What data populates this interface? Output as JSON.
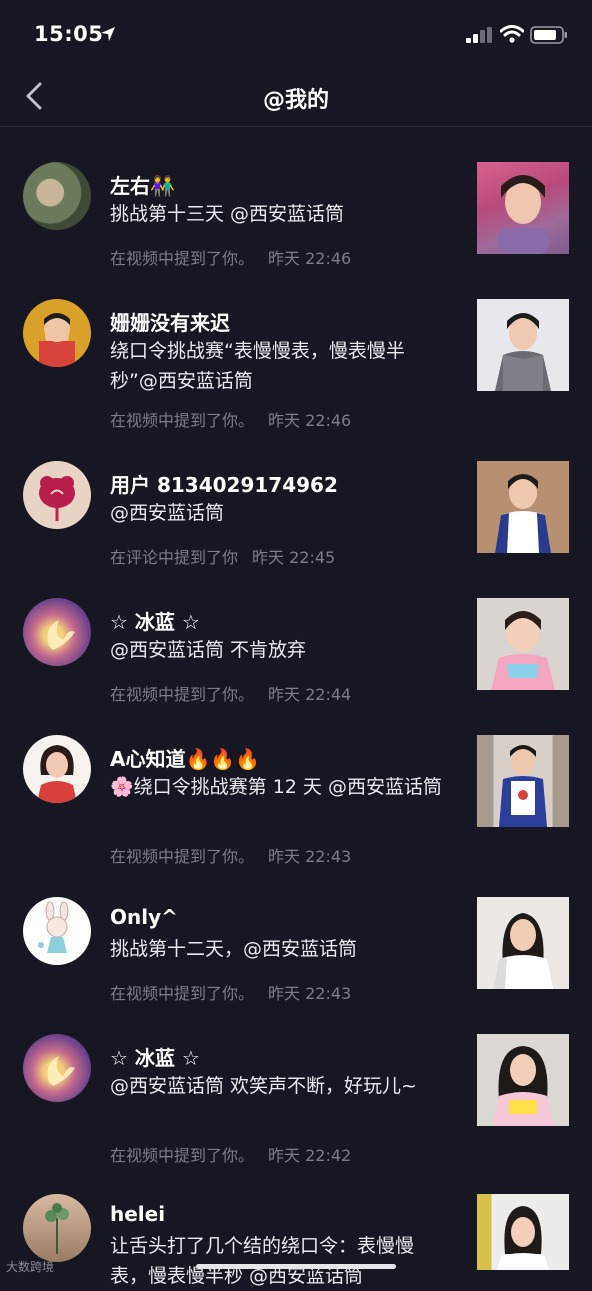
{
  "status_bar": {
    "time": "15:05"
  },
  "header": {
    "title": "@我的"
  },
  "mentions": [
    {
      "name": "左右👫",
      "message": "挑战第十三天 @西安蓝话筒",
      "source": "在视频中提到了你。",
      "time": "昨天 22:46"
    },
    {
      "name": "姗姗没有来迟",
      "message": "绕口令挑战赛“表慢慢表，慢表慢半秒”@西安蓝话筒",
      "source": "在视频中提到了你。",
      "time": "昨天 22:46"
    },
    {
      "name": "用户 8134029174962",
      "message": "@西安蓝话筒",
      "source": "在评论中提到了你",
      "time": "昨天 22:45"
    },
    {
      "name": "☆ 冰蓝 ☆",
      "message": "@西安蓝话筒 不肯放弃",
      "source": "在视频中提到了你。",
      "time": "昨天 22:44"
    },
    {
      "name": "A心知道🔥🔥🔥",
      "message": "🌸绕口令挑战赛第 12 天 @西安蓝话筒",
      "source": "在视频中提到了你。",
      "time": "昨天 22:43"
    },
    {
      "name": "Only^",
      "message": "挑战第十二天，@西安蓝话筒",
      "source": "在视频中提到了你。",
      "time": "昨天 22:43"
    },
    {
      "name": "☆ 冰蓝 ☆",
      "message": "@西安蓝话筒 欢笑声不断，好玩儿~",
      "source": "在视频中提到了你。",
      "time": "昨天 22:42"
    },
    {
      "name": "helei",
      "message": "让舌头打了几个结的绕口令：表慢慢表，慢表慢半秒 @西安蓝话筒",
      "source": "",
      "time": ""
    }
  ],
  "watermark": "大数跨境",
  "colors": {
    "background": "#161722",
    "meta": "#7c7d88"
  }
}
